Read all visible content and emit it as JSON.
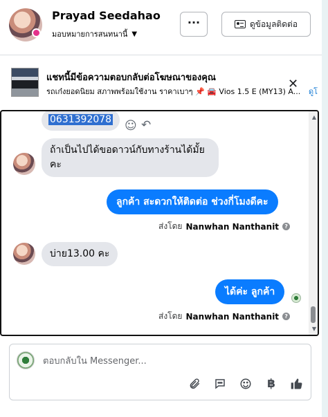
{
  "header": {
    "name": "Prayad Seedahao",
    "assignment": "มอบหมายการสนทนานี้",
    "more_label": "···",
    "contact_button": "ดูข้อมูลติดต่อ"
  },
  "ad_banner": {
    "title": "แชทนี้มีข้อความตอบกลับต่อโฆษณาของคุณ",
    "subtitle": "รถเก๋งยอดนิยม สภาพพร้อมใช้งาน ราคาเบาๆ 📌 🚘 Vios 1.5 E (MY13) A...",
    "link": "ดูโ"
  },
  "messages": {
    "m1_text": "0631392078",
    "m2_text": "ถ้าเป็นไปได้ขอดาวน์กับทางร้านได้มั้ยคะ",
    "m3_text": "ลูกค้า  สะดวกให้ติดต่อ ช่วงกี่โมงดีคะ",
    "m3_sentby_prefix": "ส่งโดย",
    "m3_sentby_name": "Nanwhan Nanthanit",
    "m4_text": "บ่าย13.00 คะ",
    "m5_text": "ได้ค่ะ  ลูกค้า",
    "m5_sentby_prefix": "ส่งโดย",
    "m5_sentby_name": "Nanwhan Nanthanit"
  },
  "composer": {
    "placeholder": "ตอบกลับใน Messenger...",
    "currency_symbol": "฿",
    "icons": [
      "paperclip-icon",
      "chat-template-icon",
      "smiley-icon",
      "baht-icon",
      "thumbs-up-icon"
    ]
  },
  "colors": {
    "outgoing_bubble": "#0a7cff",
    "incoming_bubble": "#e4e6eb",
    "selection": "#2f6fd0"
  }
}
